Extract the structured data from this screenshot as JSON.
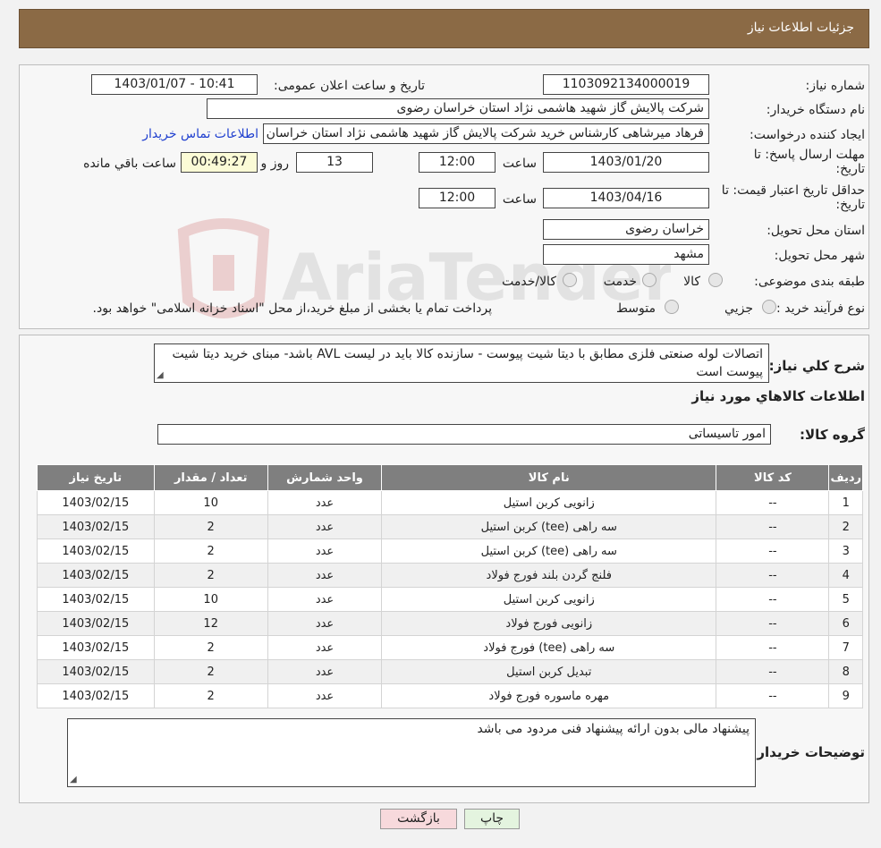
{
  "header": {
    "title": "جزئیات اطلاعات نیاز"
  },
  "form": {
    "need_number_label": "شماره نیاز:",
    "need_number": "1103092134000019",
    "announce_label": "تاریخ و ساعت اعلان عمومی:",
    "announce_value": "1403/01/07 - 10:41",
    "buyer_label": "نام دستگاه خریدار:",
    "buyer_value": "شرکت پالایش گاز شهید هاشمی نژاد   استان خراسان رضوی",
    "creator_label": "ایجاد کننده درخواست:",
    "creator_value": "فرهاد میرشاهی کارشناس خرید شرکت پالایش گاز شهید هاشمی نژاد   استان خراسان رضوی",
    "contact_link": "اطلاعات تماس خریدار",
    "deadline_label": "مهلت ارسال پاسخ: تا تاریخ:",
    "deadline_date": "1403/01/20",
    "time_label": "ساعت",
    "deadline_time": "12:00",
    "days": "13",
    "days_label": "روز و",
    "remaining": "00:49:27",
    "remaining_label": "ساعت باقي مانده",
    "validity_label": "حداقل تاریخ اعتبار قیمت: تا تاریخ:",
    "validity_date": "1403/04/16",
    "validity_time": "12:00",
    "province_label": "استان محل تحویل:",
    "province_value": "خراسان رضوی",
    "city_label": "شهر محل تحویل:",
    "city_value": "مشهد",
    "category_label": "طبقه بندی موضوعی:",
    "category_options": [
      "کالا",
      "خدمت",
      "کالا/خدمت"
    ],
    "process_label": "نوع فرآیند خرید :",
    "process_options": [
      "جزیي",
      "متوسط"
    ],
    "process_note": "پرداخت تمام یا بخشی از مبلغ خرید،از محل \"اسناد خزانه اسلامی\" خواهد بود."
  },
  "description": {
    "label": "شرح کلي نياز:",
    "text": "اتصالات لوله صنعتی فلزی مطابق با دیتا شیت پیوست - سازنده کالا باید در لیست AVL باشد- مبنای خرید دیتا شیت پیوست است"
  },
  "items_section": {
    "title": "اطلاعات کالاهاي مورد نياز",
    "group_label": "گروه کالا:",
    "group_value": "امور تاسیساتی"
  },
  "table": {
    "headers": [
      "رديف",
      "کد کالا",
      "نام کالا",
      "واحد شمارش",
      "تعداد / مقدار",
      "تاریخ نیاز"
    ],
    "rows": [
      [
        "1",
        "--",
        "زانویی کربن استیل",
        "عدد",
        "10",
        "1403/02/15"
      ],
      [
        "2",
        "--",
        "سه راهی (tee) کربن استیل",
        "عدد",
        "2",
        "1403/02/15"
      ],
      [
        "3",
        "--",
        "سه راهی (tee) کربن استیل",
        "عدد",
        "2",
        "1403/02/15"
      ],
      [
        "4",
        "--",
        "فلنج گردن بلند فورج فولاد",
        "عدد",
        "2",
        "1403/02/15"
      ],
      [
        "5",
        "--",
        "زانویی کربن استیل",
        "عدد",
        "10",
        "1403/02/15"
      ],
      [
        "6",
        "--",
        "زانویی فورج فولاد",
        "عدد",
        "12",
        "1403/02/15"
      ],
      [
        "7",
        "--",
        "سه راهی (tee) فورج فولاد",
        "عدد",
        "2",
        "1403/02/15"
      ],
      [
        "8",
        "--",
        "تبدیل کربن استیل",
        "عدد",
        "2",
        "1403/02/15"
      ],
      [
        "9",
        "--",
        "مهره ماسوره فورج فولاد",
        "عدد",
        "2",
        "1403/02/15"
      ]
    ]
  },
  "buyer_notes": {
    "label": "توضیحات خریدار:",
    "text": "پیشنهاد مالی بدون ارائه پیشنهاد فنی مردود می باشد"
  },
  "buttons": {
    "print": "چاپ",
    "back": "بازگشت"
  },
  "watermark": {
    "text": "AriaTender.neT"
  },
  "colors": {
    "header": "#8b6a45",
    "table_header": "#7f7f7f",
    "link": "#1f3fcf",
    "back_button": "#f7d9dc",
    "print_button": "#e4f4df"
  }
}
